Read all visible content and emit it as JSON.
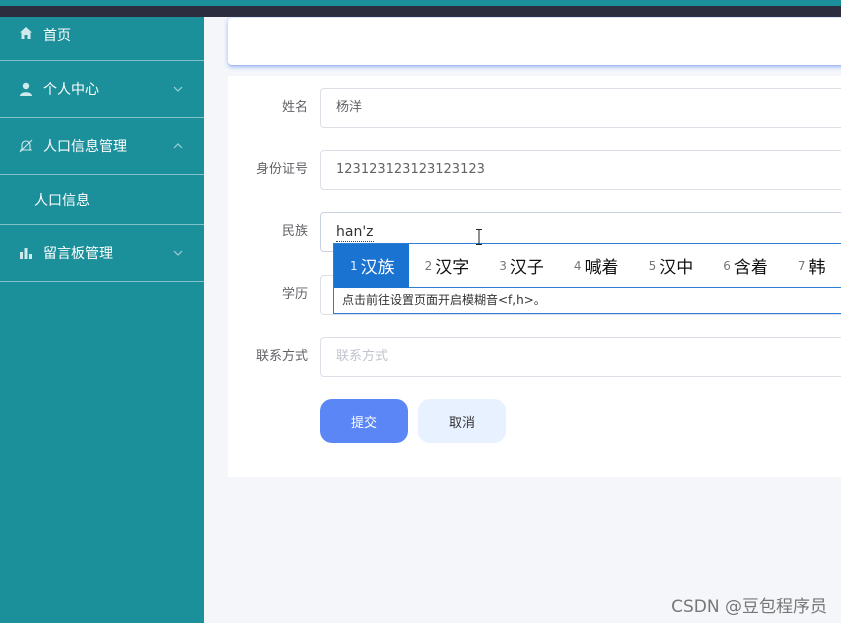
{
  "sidebar": {
    "items": [
      {
        "label": "首页",
        "icon": "home-icon"
      },
      {
        "label": "个人中心",
        "icon": "user-icon"
      },
      {
        "label": "人口信息管理",
        "icon": "bell-slash-icon",
        "expanded": true,
        "children": [
          {
            "label": "人口信息"
          }
        ]
      },
      {
        "label": "留言板管理",
        "icon": "bar-chart-icon"
      }
    ]
  },
  "form": {
    "name": {
      "label": "姓名",
      "value": "杨洋"
    },
    "id_card": {
      "label": "身份证号",
      "value": "123123123123123123"
    },
    "ethnicity": {
      "label": "民族",
      "value": "han'z"
    },
    "education": {
      "label": "学历",
      "value": ""
    },
    "contact": {
      "label": "联系方式",
      "placeholder": "联系方式"
    },
    "submit_label": "提交",
    "cancel_label": "取消"
  },
  "ime": {
    "candidates": [
      {
        "num": "1",
        "text": "汉族",
        "selected": true
      },
      {
        "num": "2",
        "text": "汉字"
      },
      {
        "num": "3",
        "text": "汉子"
      },
      {
        "num": "4",
        "text": "喊着"
      },
      {
        "num": "5",
        "text": "汉中"
      },
      {
        "num": "6",
        "text": "含着"
      },
      {
        "num": "7",
        "text": "韩"
      }
    ],
    "hint": "点击前往设置页面开启模糊音<f,h>。"
  },
  "watermark": "CSDN @豆包程序员",
  "colors": {
    "sidebar": "#1b8f9a",
    "primary": "#5b86f5",
    "ime_select": "#1a72d1"
  }
}
